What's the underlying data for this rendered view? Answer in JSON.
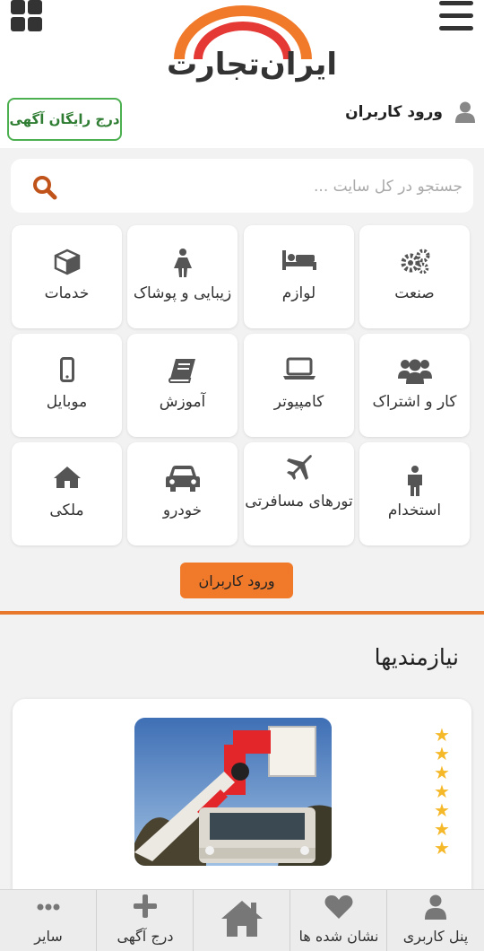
{
  "header": {
    "logo_text": "ایران‌تجارت",
    "login_label": "ورود کاربران",
    "free_ad_label": "درج رایگان آگهی"
  },
  "search": {
    "placeholder": "جستجو در کل سایت ..."
  },
  "categories": [
    {
      "label": "صنعت",
      "icon": "gears-icon"
    },
    {
      "label": "لوازم",
      "icon": "bed-icon"
    },
    {
      "label": "زیبایی و پوشاک",
      "icon": "woman-icon"
    },
    {
      "label": "خدمات",
      "icon": "cube-icon"
    },
    {
      "label": "کار و اشتراک",
      "icon": "users-icon"
    },
    {
      "label": "کامپیوتر",
      "icon": "laptop-icon"
    },
    {
      "label": "آموزش",
      "icon": "book-icon"
    },
    {
      "label": "موبایل",
      "icon": "mobile-icon"
    },
    {
      "label": "استخدام",
      "icon": "person-icon"
    },
    {
      "label": "تورهای مسافرتی",
      "icon": "plane-icon"
    },
    {
      "label": "خودرو",
      "icon": "car-icon"
    },
    {
      "label": "ملکی",
      "icon": "home-icon"
    }
  ],
  "login_button": "ورود کاربران",
  "section": {
    "title": "نیازمندیها"
  },
  "listing": {
    "stars": 7,
    "image_icon": "crane-truck-image"
  },
  "bottom_nav": [
    {
      "label": "پنل کاربری",
      "icon": "user-icon"
    },
    {
      "label": "نشان شده ها",
      "icon": "heart-icon"
    },
    {
      "label": "",
      "icon": "home-icon"
    },
    {
      "label": "درج آگهی",
      "icon": "plus-icon"
    },
    {
      "label": "سایر",
      "icon": "ellipsis-icon"
    }
  ],
  "colors": {
    "accent": "#f07a2a",
    "green": "#4caf50",
    "star": "#f5b829",
    "logo_red": "#e53935"
  }
}
